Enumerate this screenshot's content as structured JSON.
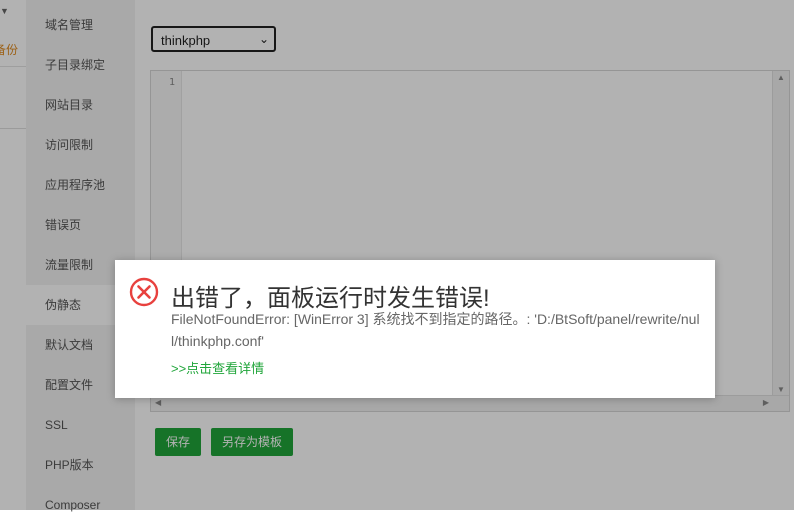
{
  "left_panel": {
    "backup_label": "备份"
  },
  "sidebar": {
    "items": [
      {
        "label": "域名管理"
      },
      {
        "label": "子目录绑定"
      },
      {
        "label": "网站目录"
      },
      {
        "label": "访问限制"
      },
      {
        "label": "应用程序池"
      },
      {
        "label": "错误页"
      },
      {
        "label": "流量限制"
      },
      {
        "label": "伪静态"
      },
      {
        "label": "默认文档"
      },
      {
        "label": "配置文件"
      },
      {
        "label": "SSL"
      },
      {
        "label": "PHP版本"
      },
      {
        "label": "Composer"
      }
    ],
    "active_label": "伪静态"
  },
  "rewrite": {
    "selected_template": "thinkphp",
    "editor": {
      "line_number": "1"
    },
    "save_label": "保存",
    "save_template_label": "另存为模板"
  },
  "dialog": {
    "title": "出错了，面板运行时发生错误!",
    "message": "FileNotFoundError: [WinError 3] 系统找不到指定的路径。: 'D:/BtSoft/panel/rewrite/null/thinkphp.conf'",
    "details_link": ">>点击查看详情"
  },
  "colors": {
    "accent_green": "#20a53a",
    "error_red": "#e8413e",
    "backup_orange": "#e08a1e"
  },
  "icons": {
    "error": "error-circle-x-icon"
  }
}
